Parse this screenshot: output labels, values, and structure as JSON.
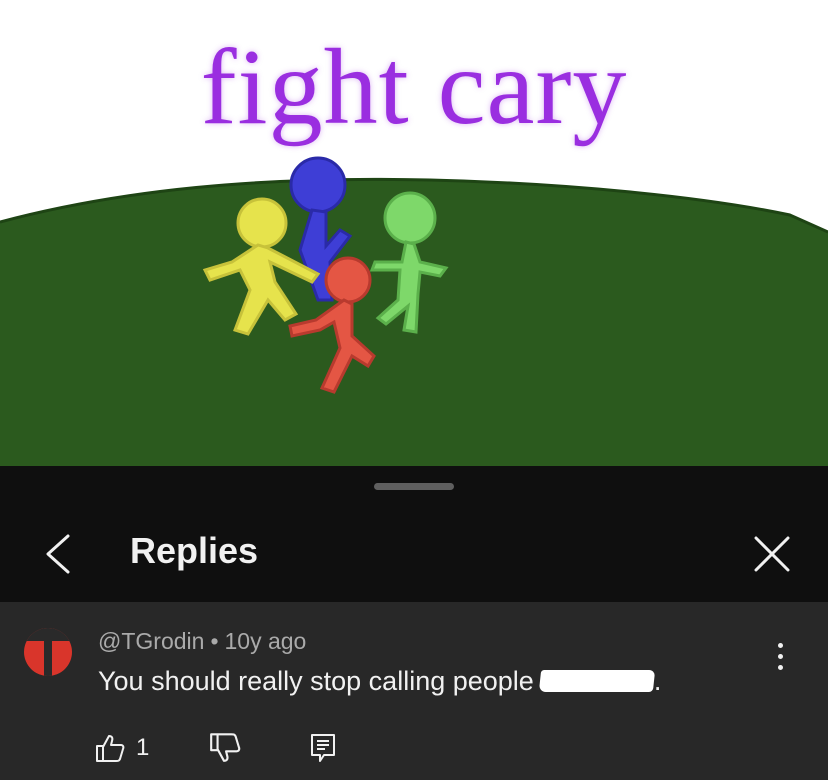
{
  "video": {
    "title_text": "fight cary",
    "colors": {
      "title": "#9a2ee0",
      "ground": "#2b5a1e",
      "figure_yellow": "#e6e34c",
      "figure_blue": "#3e3ed6",
      "figure_green": "#7ed86a",
      "figure_red": "#e45644"
    }
  },
  "sheet": {
    "title": "Replies",
    "back_icon": "chevron-left-icon",
    "close_icon": "close-icon"
  },
  "comment": {
    "author": "@TGrodin",
    "separator": "•",
    "time": "10y ago",
    "text_before": "You should really stop calling people",
    "text_after": ".",
    "like_count": "1",
    "icons": [
      "thumb-up-icon",
      "thumb-down-icon",
      "reply-icon",
      "more-vert-icon"
    ]
  }
}
